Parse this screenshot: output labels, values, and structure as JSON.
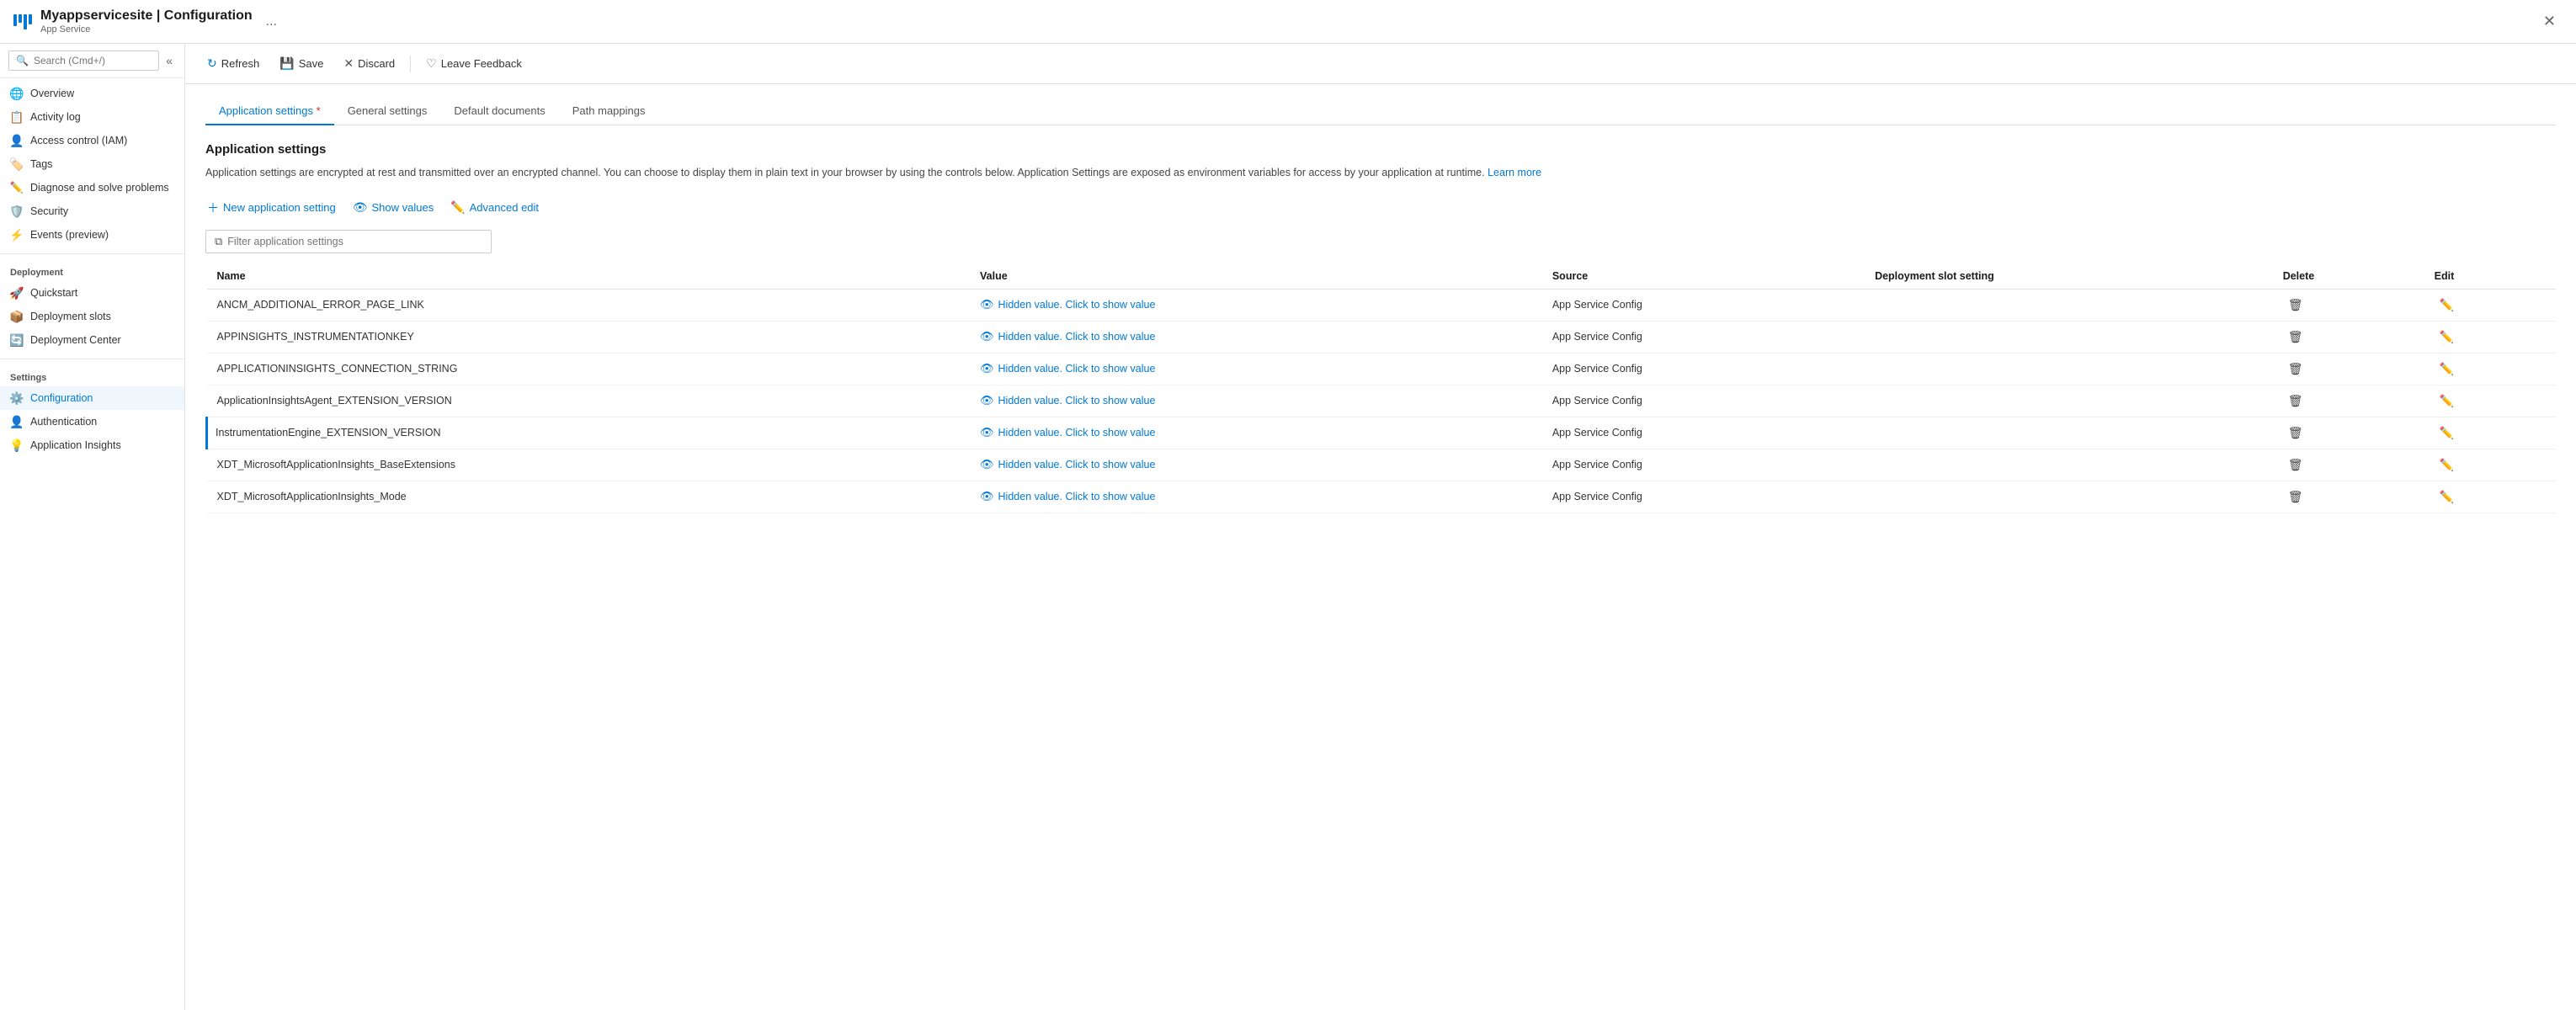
{
  "window": {
    "title": "Myappservicesite | Configuration",
    "subtitle": "App Service",
    "close_label": "✕",
    "ellipsis_label": "..."
  },
  "toolbar": {
    "refresh_label": "Refresh",
    "save_label": "Save",
    "discard_label": "Discard",
    "feedback_label": "Leave Feedback"
  },
  "search": {
    "placeholder": "Search (Cmd+/)"
  },
  "nav": {
    "items": [
      {
        "id": "overview",
        "label": "Overview",
        "icon": "🌐"
      },
      {
        "id": "activity-log",
        "label": "Activity log",
        "icon": "📋"
      },
      {
        "id": "access-control",
        "label": "Access control (IAM)",
        "icon": "👤"
      },
      {
        "id": "tags",
        "label": "Tags",
        "icon": "🏷️"
      },
      {
        "id": "diagnose",
        "label": "Diagnose and solve problems",
        "icon": "✏️"
      },
      {
        "id": "security",
        "label": "Security",
        "icon": "🛡️"
      },
      {
        "id": "events",
        "label": "Events (preview)",
        "icon": "⚡"
      }
    ],
    "sections": [
      {
        "label": "Deployment",
        "items": [
          {
            "id": "quickstart",
            "label": "Quickstart",
            "icon": "🚀"
          },
          {
            "id": "deployment-slots",
            "label": "Deployment slots",
            "icon": "📦"
          },
          {
            "id": "deployment-center",
            "label": "Deployment Center",
            "icon": "🔄"
          }
        ]
      },
      {
        "label": "Settings",
        "items": [
          {
            "id": "configuration",
            "label": "Configuration",
            "icon": "⚙️",
            "active": true
          },
          {
            "id": "authentication",
            "label": "Authentication",
            "icon": "👤"
          },
          {
            "id": "app-insights",
            "label": "Application Insights",
            "icon": "💡"
          }
        ]
      }
    ]
  },
  "tabs": [
    {
      "id": "app-settings",
      "label": "Application settings",
      "asterisk": true,
      "active": true
    },
    {
      "id": "general-settings",
      "label": "General settings",
      "active": false
    },
    {
      "id": "default-docs",
      "label": "Default documents",
      "active": false
    },
    {
      "id": "path-mappings",
      "label": "Path mappings",
      "active": false
    }
  ],
  "page": {
    "heading": "Application settings",
    "description": "Application settings are encrypted at rest and transmitted over an encrypted channel. You can choose to display them in plain text in your browser by using the controls below. Application Settings are exposed as environment variables for access by your application at runtime.",
    "learn_more": "Learn more"
  },
  "actions": {
    "new_setting": "New application setting",
    "show_values": "Show values",
    "advanced_edit": "Advanced edit"
  },
  "filter": {
    "placeholder": "Filter application settings"
  },
  "table": {
    "columns": [
      "Name",
      "Value",
      "Source",
      "Deployment slot setting",
      "Delete",
      "Edit"
    ],
    "rows": [
      {
        "name": "ANCM_ADDITIONAL_ERROR_PAGE_LINK",
        "value": "Hidden value. Click to show value",
        "source": "App Service Config",
        "slot_setting": "",
        "accent": false
      },
      {
        "name": "APPINSIGHTS_INSTRUMENTATIONKEY",
        "value": "Hidden value. Click to show value",
        "source": "App Service Config",
        "slot_setting": "",
        "accent": false
      },
      {
        "name": "APPLICATIONINSIGHTS_CONNECTION_STRING",
        "value": "Hidden value. Click to show value",
        "source": "App Service Config",
        "slot_setting": "",
        "accent": false
      },
      {
        "name": "ApplicationInsightsAgent_EXTENSION_VERSION",
        "value": "Hidden value. Click to show value",
        "source": "App Service Config",
        "slot_setting": "",
        "accent": false
      },
      {
        "name": "InstrumentationEngine_EXTENSION_VERSION",
        "value": "Hidden value. Click to show value",
        "source": "App Service Config",
        "slot_setting": "",
        "accent": true
      },
      {
        "name": "XDT_MicrosoftApplicationInsights_BaseExtensions",
        "value": "Hidden value. Click to show value",
        "source": "App Service Config",
        "slot_setting": "",
        "accent": false
      },
      {
        "name": "XDT_MicrosoftApplicationInsights_Mode",
        "value": "Hidden value. Click to show value",
        "source": "App Service Config",
        "slot_setting": "",
        "accent": false
      }
    ]
  }
}
